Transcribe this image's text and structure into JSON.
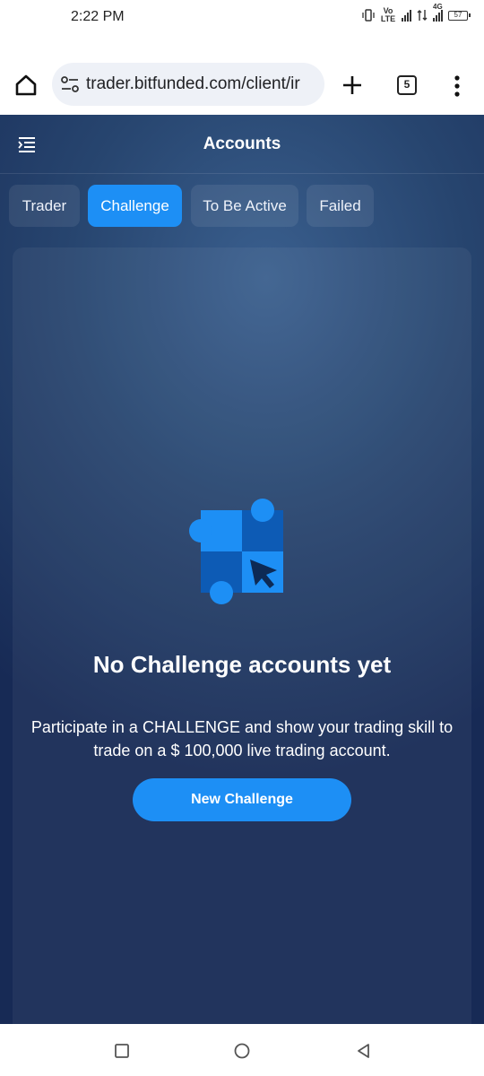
{
  "status_bar": {
    "time": "2:22 PM",
    "network_label": "Vo LTE",
    "network_type": "4G",
    "battery_level": "57",
    "icons": [
      "vibrate-icon",
      "volte-icon",
      "signal-icon",
      "data-arrows-icon",
      "signal-4g-icon",
      "battery-icon"
    ]
  },
  "browser": {
    "url": "trader.bitfunded.com/client/ir",
    "tab_count": "5",
    "icons": [
      "home-icon",
      "site-settings-icon",
      "plus-icon",
      "tabs-icon",
      "more-vert-icon"
    ]
  },
  "app": {
    "title": "Accounts",
    "tabs": [
      {
        "label": "Trader",
        "active": false
      },
      {
        "label": "Challenge",
        "active": true
      },
      {
        "label": "To Be Active",
        "active": false
      },
      {
        "label": "Failed",
        "active": false
      }
    ],
    "empty_state": {
      "title": "No Challenge accounts yet",
      "description": "Participate in a CHALLENGE and show your trading skill to trade on a $ 100,000 live trading account.",
      "button_label": "New Challenge"
    }
  },
  "colors": {
    "accent": "#1d8ff5",
    "background_top": "#3a5f8e",
    "background_bottom": "#172a55"
  }
}
